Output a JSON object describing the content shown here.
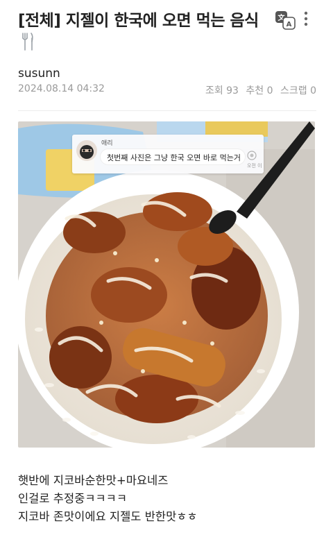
{
  "post": {
    "title": "[전체] 지젤이 한국에 오면 먹는 음식",
    "author": "susunn",
    "date": "2024.08.14 04:32",
    "views": "조회 93",
    "likes": "추천 0",
    "scraps": "스크랩 0"
  },
  "icons": {
    "title_emoji": "fork-and-knife-icon",
    "translate": "translate-icon",
    "more": "more-vertical-icon"
  },
  "image_overlay": {
    "commenter_name": "애리",
    "comment": "첫번째 사진은 그냥 한국 오면 바로 먹는거",
    "side_label": "오전 이"
  },
  "content": {
    "lines": [
      "햇반에 지코바순한맛+마요네즈",
      "인걸로 추정중ㅋㅋㅋㅋ",
      "지코바 존맛이에요 지젤도 반한맛ㅎㅎ"
    ]
  },
  "colors": {
    "meta_text": "#9a9a9a",
    "title_text": "#222222",
    "divider": "#ececec"
  }
}
